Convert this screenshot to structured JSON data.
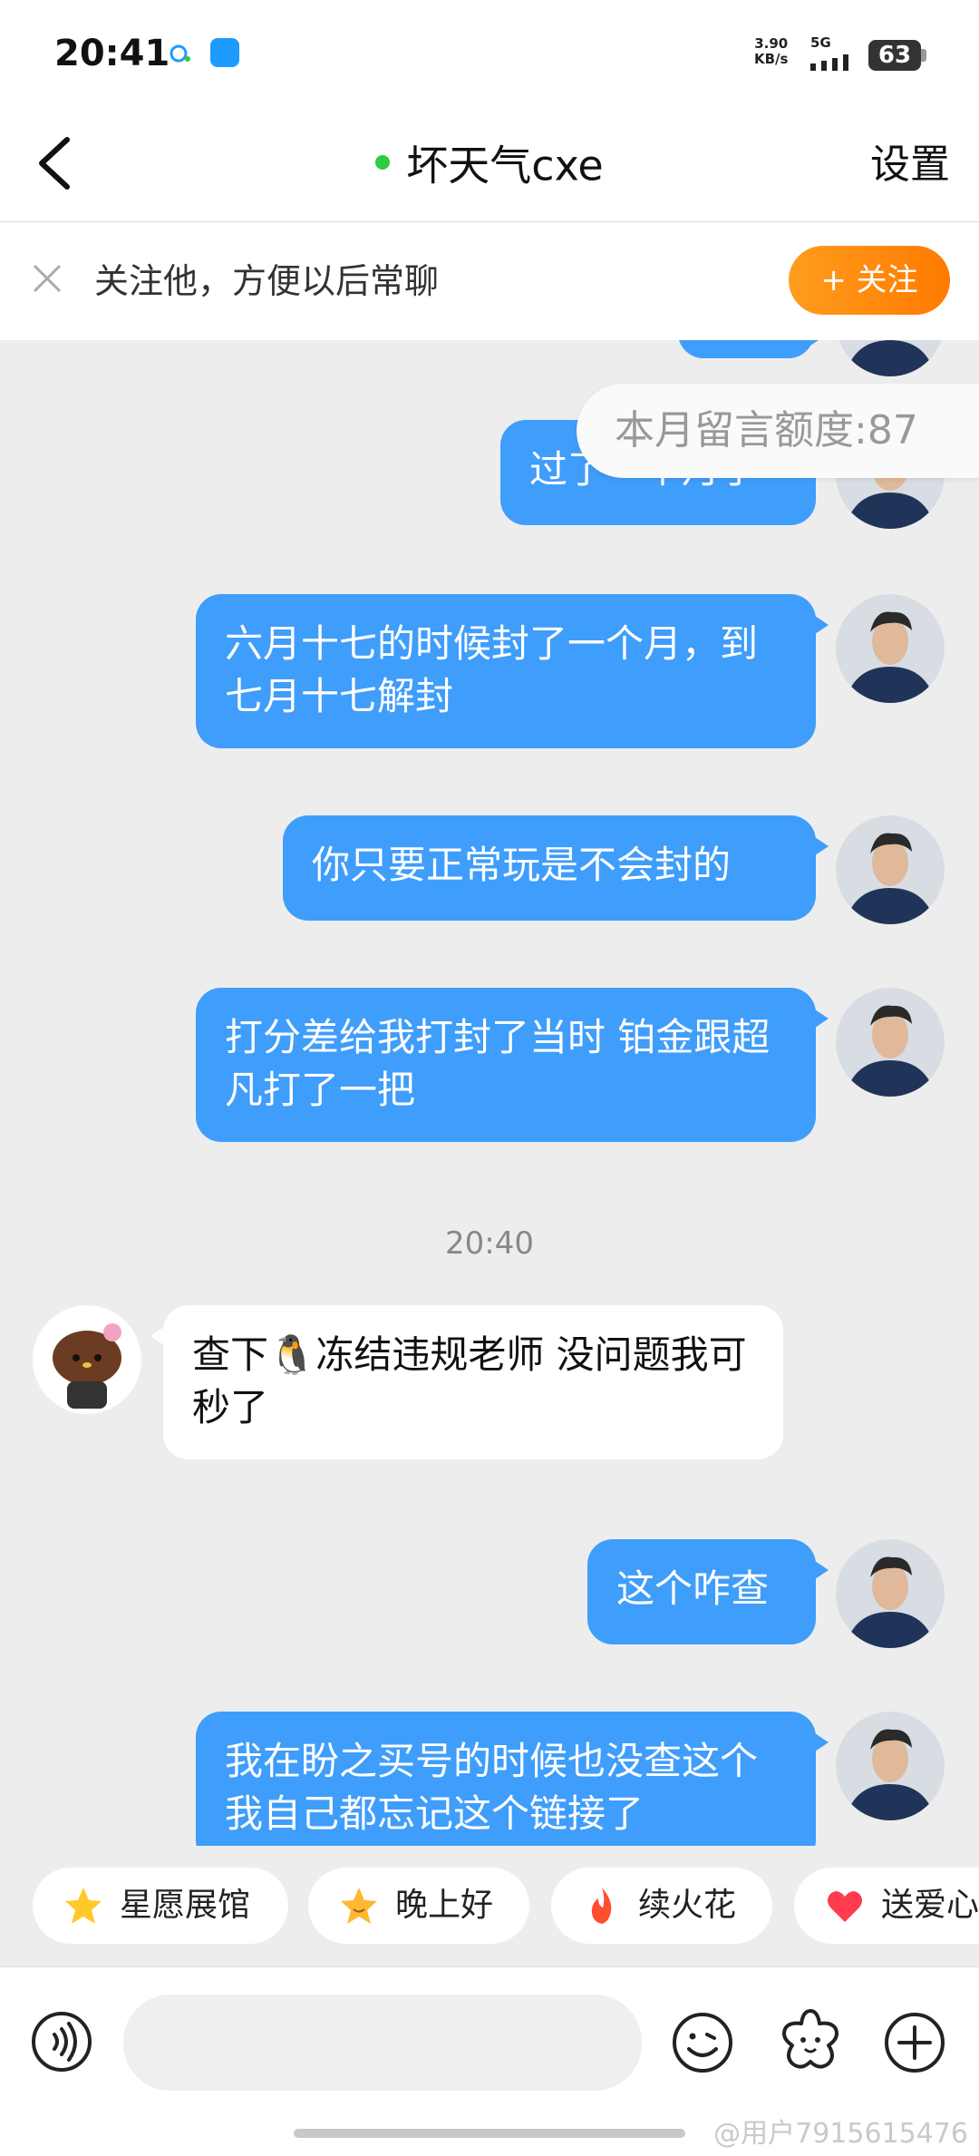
{
  "status_bar": {
    "time": "20:41",
    "net_speed": "3.90",
    "net_unit": "KB/s",
    "network": "5G",
    "battery": "63"
  },
  "header": {
    "title": "坏天气cxe",
    "settings_label": "设置"
  },
  "follow_banner": {
    "text": "关注他，方便以后常聊",
    "button_label": "+ 关注"
  },
  "quota_tip": "本月留言额度:87",
  "messages": [
    {
      "from": "me",
      "text": "过了一个月了"
    },
    {
      "from": "me",
      "text": "六月十七的时候封了一个月，到七月十七解封"
    },
    {
      "from": "me",
      "text": "你只要正常玩是不会封的"
    },
    {
      "from": "me",
      "text": "打分差给我打封了当时  铂金跟超凡打了一把"
    },
    {
      "from": "system",
      "text": "20:40"
    },
    {
      "from": "other",
      "text_before": "查下",
      "emoji": "🐧",
      "text_after": "冻结违规老师 没问题我可秒了"
    },
    {
      "from": "me",
      "text": "这个咋查"
    },
    {
      "from": "me",
      "text": "我在盼之买号的时候也没查这个  我自己都忘记这个链接了"
    }
  ],
  "quick_replies": [
    {
      "label": "星愿展馆",
      "icon": "star-icon"
    },
    {
      "label": "晚上好",
      "icon": "smile-star-icon"
    },
    {
      "label": "续火花",
      "icon": "fire-icon"
    },
    {
      "label": "送爱心",
      "icon": "heart-icon"
    }
  ],
  "input": {
    "placeholder": ""
  },
  "watermark": "@用户7915615476",
  "colors": {
    "my_bubble": "#3f9dfb",
    "follow_button": "#ff8a00",
    "online": "#2ecc40"
  }
}
